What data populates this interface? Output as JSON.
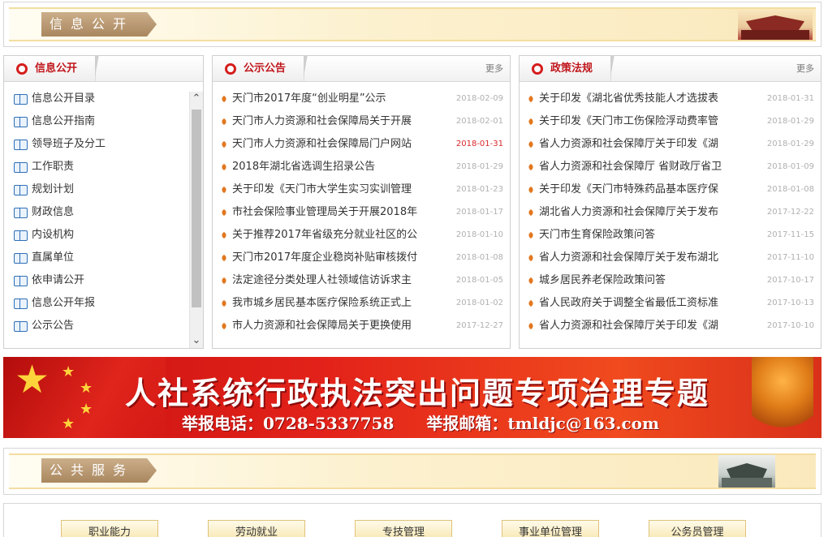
{
  "info_banner": {
    "label": "信息公开"
  },
  "left_panel": {
    "title": "信息公开",
    "items": [
      "信息公开目录",
      "信息公开指南",
      "领导班子及分工",
      "工作职责",
      "规划计划",
      "财政信息",
      "内设机构",
      "直属单位",
      "依申请公开",
      "信息公开年报",
      "公示公告"
    ],
    "scroll_up": "⌃",
    "scroll_down": "⌄"
  },
  "notice_panel": {
    "title": "公示公告",
    "more": "更多",
    "items": [
      {
        "title": "天门市2017年度“创业明星”公示",
        "date": "2018-02-09"
      },
      {
        "title": "天门市人力资源和社会保障局关于开展",
        "date": "2018-02-01"
      },
      {
        "title": "天门市人力资源和社会保障局门户网站",
        "date": "2018-01-31"
      },
      {
        "title": "2018年湖北省选调生招录公告",
        "date": "2018-01-29"
      },
      {
        "title": "关于印发《天门市大学生实习实训管理",
        "date": "2018-01-23"
      },
      {
        "title": "市社会保险事业管理局关于开展2018年",
        "date": "2018-01-17"
      },
      {
        "title": "关于推荐2017年省级充分就业社区的公",
        "date": "2018-01-10"
      },
      {
        "title": "天门市2017年度企业稳岗补贴审核拨付",
        "date": "2018-01-08"
      },
      {
        "title": "法定途径分类处理人社领域信访诉求主",
        "date": "2018-01-05"
      },
      {
        "title": "我市城乡居民基本医疗保险系统正式上",
        "date": "2018-01-02"
      },
      {
        "title": "市人力资源和社会保障局关于更换使用",
        "date": "2017-12-27"
      }
    ],
    "highlight_color": "#d8282b"
  },
  "policy_panel": {
    "title": "政策法规",
    "more": "更多",
    "items": [
      {
        "title": "关于印发《湖北省优秀技能人才选拔表",
        "date": "2018-01-31"
      },
      {
        "title": "关于印发《天门市工伤保险浮动费率管",
        "date": "2018-01-29"
      },
      {
        "title": "省人力资源和社会保障厅关于印发《湖",
        "date": "2018-01-29"
      },
      {
        "title": "省人力资源和社会保障厅 省财政厅省卫",
        "date": "2018-01-09"
      },
      {
        "title": "关于印发《天门市特殊药品基本医疗保",
        "date": "2018-01-08"
      },
      {
        "title": "湖北省人力资源和社会保障厅关于发布",
        "date": "2017-12-22"
      },
      {
        "title": "天门市生育保险政策问答",
        "date": "2017-11-15"
      },
      {
        "title": "省人力资源和社会保障厅关于发布湖北",
        "date": "2017-11-10"
      },
      {
        "title": "城乡居民养老保险政策问答",
        "date": "2017-10-17"
      },
      {
        "title": "省人民政府关于调整全省最低工资标准",
        "date": "2017-10-13"
      },
      {
        "title": "省人力资源和社会保障厅关于印发《湖",
        "date": "2017-10-10"
      }
    ]
  },
  "promo": {
    "title": "人社系统行政执法突出问题专项治理专题",
    "phone": "举报电话：0728-5337758",
    "email": "举报邮箱：tmldjc@163.com"
  },
  "service_banner": {
    "label": "公共服务"
  },
  "services": [
    "职业能力",
    "劳动就业",
    "专技管理",
    "事业单位管理",
    "公务员管理"
  ],
  "colors": {
    "accent_red": "#c0161c",
    "bullet_orange": "#e2771e",
    "date_grey": "#b0b0b0",
    "icon_blue": "#2d6fb8"
  }
}
